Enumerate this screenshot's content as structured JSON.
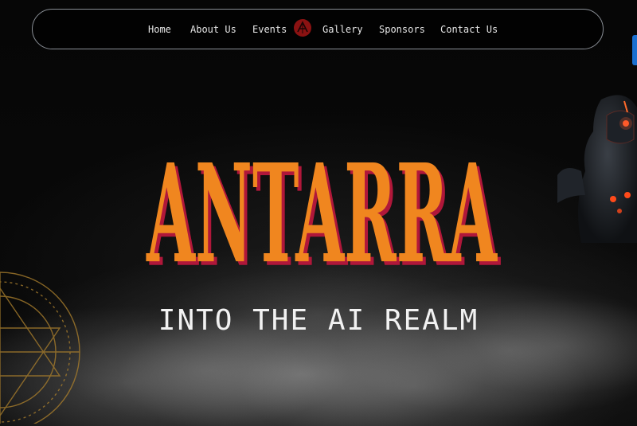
{
  "nav": {
    "items": [
      {
        "label": "Home"
      },
      {
        "label": "About Us"
      },
      {
        "label": "Events"
      },
      {
        "label": "Gallery"
      },
      {
        "label": "Sponsors"
      },
      {
        "label": "Contact Us"
      }
    ],
    "logo_icon": "antarra-logo-icon"
  },
  "hero": {
    "title": "ANTARRA",
    "subtitle": "INTO THE AI REALM",
    "title_color": "#f0861f",
    "title_shadow_color": "#b0173a"
  },
  "decor": {
    "ring_icon": "golden-ring-icon",
    "robot_icon": "robot-figure-icon"
  },
  "colors": {
    "background": "#050505",
    "nav_border": "#8a8f96",
    "accent_blue": "#1a6fd0"
  }
}
